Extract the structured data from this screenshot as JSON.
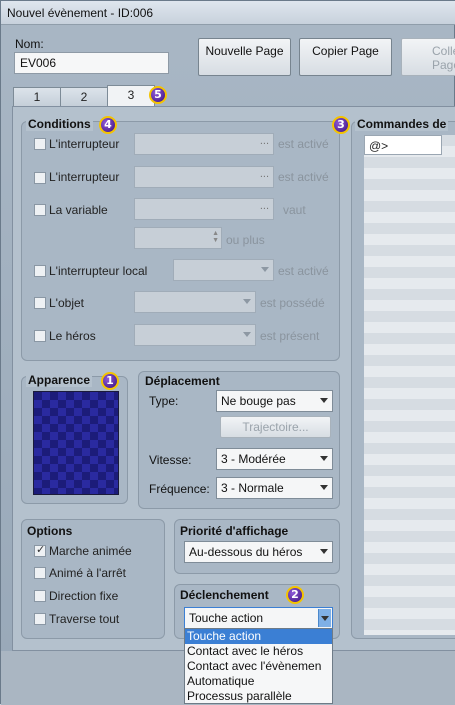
{
  "window": {
    "title": "Nouvel évènement - ID:006"
  },
  "name": {
    "label": "Nom:",
    "value": "EV006"
  },
  "page_buttons": {
    "new": "Nouvelle Page",
    "copy": "Copier Page",
    "paste": "Colle Page"
  },
  "tabs": [
    "1",
    "2",
    "3"
  ],
  "badges": {
    "tabs": "5",
    "conditions": "4",
    "commands": "3",
    "appearance": "1",
    "trigger": "2"
  },
  "conditions": {
    "title": "Conditions",
    "switch1": {
      "label": "L'interrupteur",
      "suffix": "est activé",
      "button": "..."
    },
    "switch2": {
      "label": "L'interrupteur",
      "suffix": "est activé",
      "button": "..."
    },
    "variable": {
      "label": "La variable",
      "suffix": "vaut",
      "button": "...",
      "more": "ou plus"
    },
    "local": {
      "label": "L'interrupteur local",
      "suffix": "est activé"
    },
    "item": {
      "label": "L'objet",
      "suffix": "est possédé"
    },
    "hero": {
      "label": "Le héros",
      "suffix": "est présent"
    }
  },
  "commands": {
    "title": "Commandes de",
    "first": "@>"
  },
  "appearance": {
    "title": "Apparence"
  },
  "movement": {
    "title": "Déplacement",
    "type": {
      "label": "Type:",
      "value": "Ne bouge pas"
    },
    "route_button": "Trajectoire...",
    "speed": {
      "label": "Vitesse:",
      "value": "3 - Modérée"
    },
    "frequency": {
      "label": "Fréquence:",
      "value": "3 - Normale"
    }
  },
  "options": {
    "title": "Options",
    "items": [
      {
        "label": "Marche animée",
        "checked": true
      },
      {
        "label": "Animé à l'arrêt",
        "checked": false
      },
      {
        "label": "Direction fixe",
        "checked": false
      },
      {
        "label": "Traverse tout",
        "checked": false
      }
    ]
  },
  "priority": {
    "title": "Priorité d'affichage",
    "value": "Au-dessous du héros"
  },
  "trigger": {
    "title": "Déclenchement",
    "value": "Touche action",
    "options": [
      "Touche action",
      "Contact avec le héros",
      "Contact avec l'évènemen",
      "Automatique",
      "Processus parallèle"
    ]
  }
}
